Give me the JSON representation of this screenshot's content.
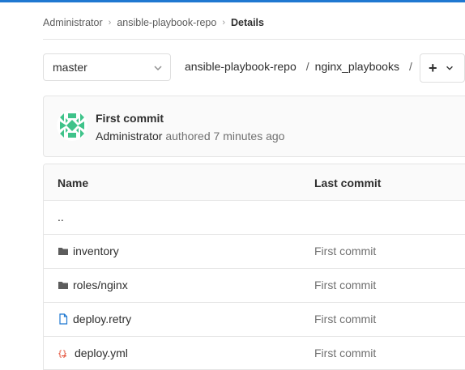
{
  "breadcrumb": {
    "items": [
      "Administrator",
      "ansible-playbook-repo"
    ],
    "current": "Details"
  },
  "toolbar": {
    "branch": "master",
    "path": [
      "ansible-playbook-repo",
      "nginx_playbooks"
    ],
    "separator": "/",
    "add_label": "+"
  },
  "commit": {
    "title": "First commit",
    "author": "Administrator",
    "meta_suffix": "authored 7 minutes ago"
  },
  "table": {
    "headers": {
      "name": "Name",
      "last_commit": "Last commit"
    },
    "parent": "..",
    "rows": [
      {
        "name": "inventory",
        "commit": "First commit",
        "icon": "folder-icon"
      },
      {
        "name": "roles/nginx",
        "commit": "First commit",
        "icon": "folder-icon"
      },
      {
        "name": "deploy.retry",
        "commit": "First commit",
        "icon": "file-icon"
      },
      {
        "name": "deploy.yml",
        "commit": "First commit",
        "icon": "yaml-file-icon"
      }
    ]
  },
  "colors": {
    "accent": "#1f78d1",
    "avatar": "#3fc38a",
    "yaml_icon": "#e24329",
    "file_icon": "#1f78d1"
  }
}
